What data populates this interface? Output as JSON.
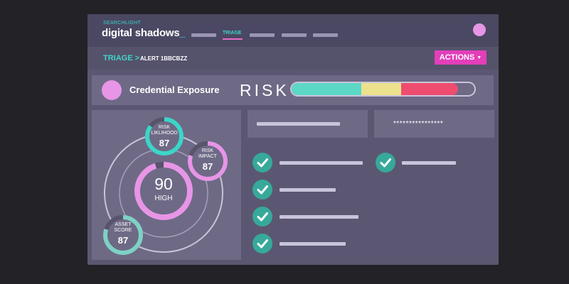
{
  "brand": {
    "small": "SEARCHLIGHT",
    "name": "digital shadows",
    "cursor": "_"
  },
  "nav": {
    "active_label": "TRIAGE"
  },
  "breadcrumb": {
    "section": "TRIAGE >",
    "alert": "ALERT 1BBCBZZ"
  },
  "actions": {
    "label": "ACTIONS",
    "caret": "▼"
  },
  "risk_banner": {
    "type_label": "Credential Exposure",
    "risk_word": "RISK",
    "segments": [
      {
        "color": "#5dd8c6",
        "fraction": 0.38
      },
      {
        "color": "#ece18c",
        "fraction": 0.22
      },
      {
        "color": "#ef4d6f",
        "fraction": 0.31
      }
    ],
    "track_color": "#6e6a86"
  },
  "scores": {
    "main": {
      "value": "90",
      "label": "HIGH",
      "color": "#e795e6",
      "fill": 0.95
    },
    "likelihood": {
      "line1": "RISK",
      "line2": "LIKLIHOOD",
      "value": "87",
      "color": "#3dd5c8",
      "fill": 0.85
    },
    "impact": {
      "line1": "RISK",
      "line2": "IMPACT",
      "value": "87",
      "color": "#e795e6",
      "fill": 0.8
    },
    "asset": {
      "line1": "ASSET",
      "line2": "SCORE",
      "value": "87",
      "color": "#7fd1c4",
      "fill": 0.8
    }
  },
  "fields": {
    "password_mask": "****************"
  },
  "checklist": {
    "icon": "check-icon",
    "color": "#37a99b"
  }
}
